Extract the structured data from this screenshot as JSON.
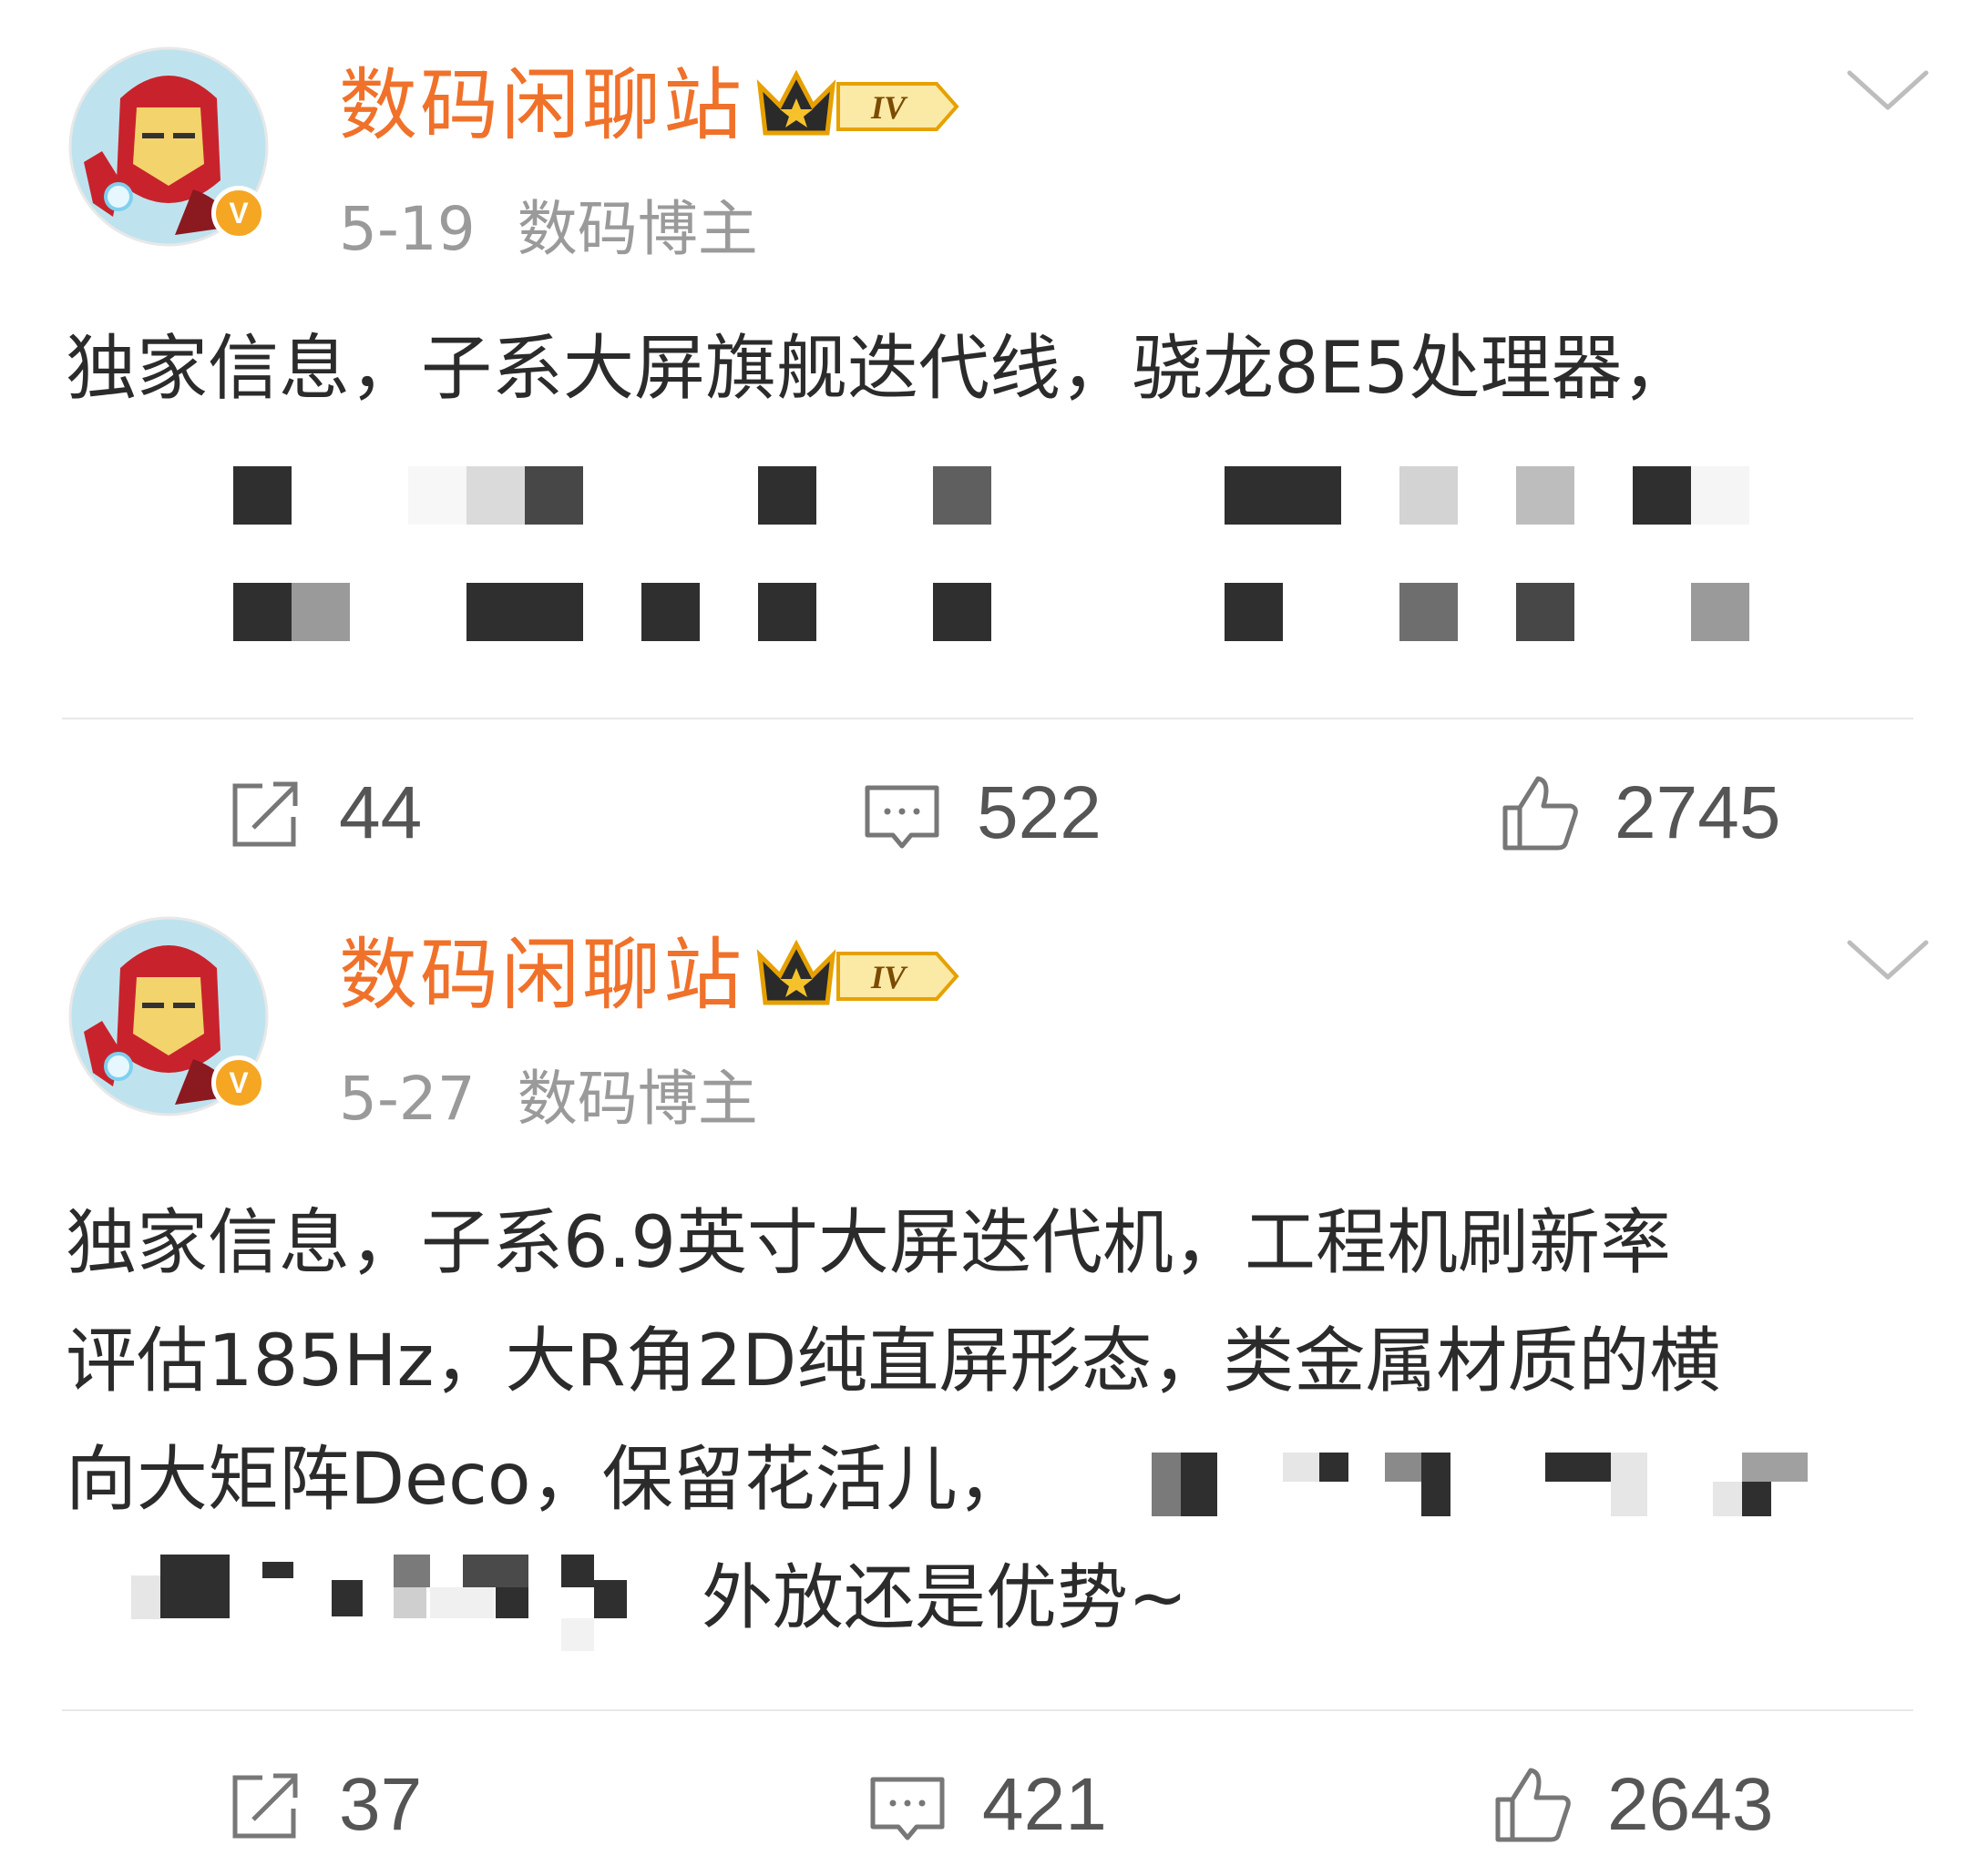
{
  "posts": [
    {
      "author": "数码闲聊站",
      "level_badge": "IV",
      "verified_badge": "V",
      "date": "5-19",
      "source": "数码博主",
      "text_lines": [
        "独家信息，子系大屏旗舰迭代线，骁龙8E5处理器，"
      ],
      "actions": {
        "repost": "44",
        "comment": "522",
        "like": "2745"
      }
    },
    {
      "author": "数码闲聊站",
      "level_badge": "IV",
      "verified_badge": "V",
      "date": "5-27",
      "source": "数码博主",
      "text_lines": [
        "独家信息，子系6.9英寸大屏迭代机，工程机刷新率",
        "评估185Hz，大R角2D纯直屏形态，类金属材质的横",
        "向大矩阵Deco，保留花活儿，",
        "外放还是优势~"
      ],
      "actions": {
        "repost": "37",
        "comment": "421",
        "like": "2643"
      }
    }
  ],
  "colors": {
    "name": "#f0712a",
    "meta": "#9a9a9a",
    "text": "#2b2b2b",
    "badge_bg": "#f5a623"
  },
  "icons": [
    "avatar-ironman",
    "crown-icon",
    "chevron-down-icon",
    "repost-icon",
    "comment-icon",
    "like-icon"
  ]
}
